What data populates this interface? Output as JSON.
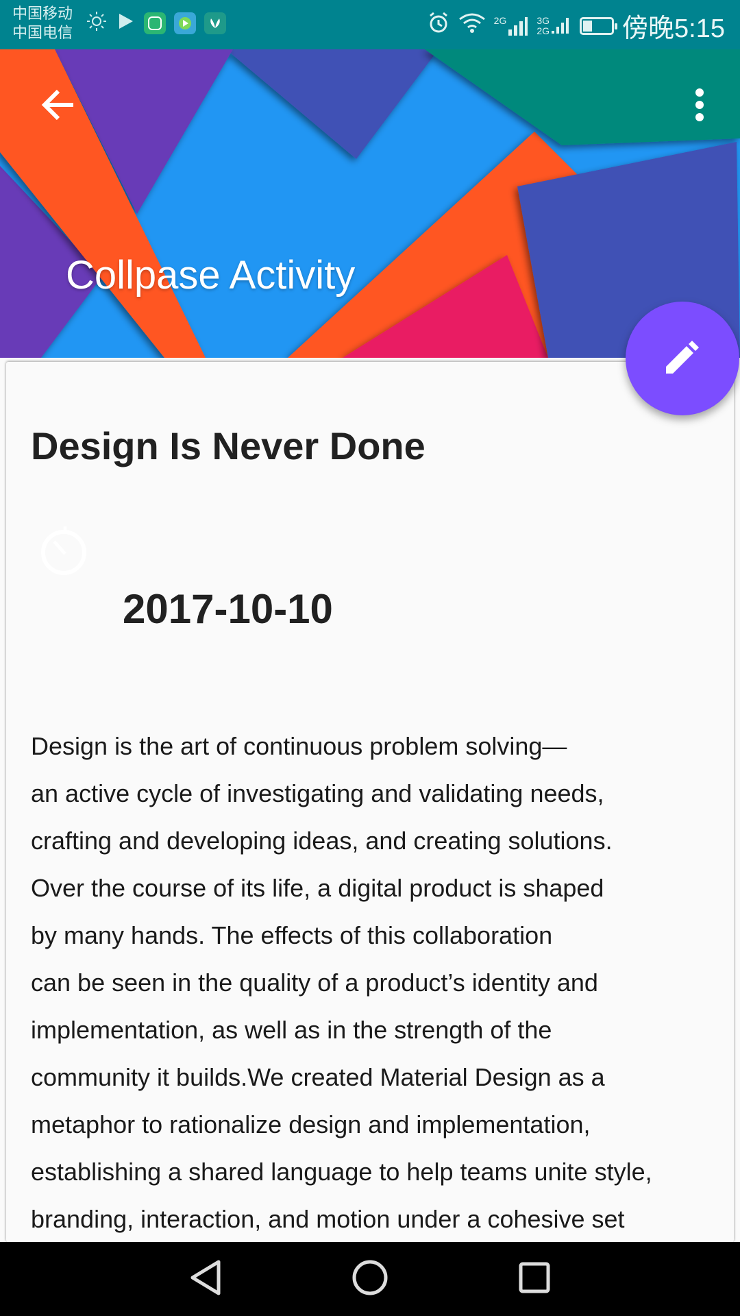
{
  "status_bar": {
    "carrier_1": "中国移动",
    "carrier_2": "中国电信",
    "app_icons": [
      "sun-icon",
      "play-store-icon",
      "meituan-icon",
      "video-icon",
      "huawei-icon"
    ],
    "net_top": "2G",
    "net_mid_1": "3G",
    "net_mid_2": "2G",
    "time": "傍晚5:15",
    "battery_level": 0.3
  },
  "toolbar": {
    "title": "Collpase Activity",
    "back_icon": "arrow-back-icon",
    "overflow_icon": "more-vert-icon"
  },
  "fab": {
    "icon": "edit-icon",
    "color": "#7c4dff"
  },
  "article": {
    "title": "Design Is Never Done",
    "date_icon": "clock-icon",
    "date": "2017-10-10",
    "body_lines": [
      "Design is the art of continuous problem solving—",
      "an active cycle of investigating and validating needs,",
      "crafting and developing ideas, and creating solutions.",
      "Over the course of its life, a digital product is shaped",
      "by many hands. The effects of this collaboration",
      "can be seen in the quality of a product’s identity and",
      "implementation, as well as in the strength of the",
      "community it builds.We created Material Design as a",
      "metaphor to rationalize design and implementation,",
      "establishing a shared language to help teams unite style,",
      "branding, interaction, and motion under a cohesive set"
    ]
  },
  "nav_bar": {
    "back": "nav-back-icon",
    "home": "nav-home-icon",
    "recents": "nav-recents-icon"
  },
  "colors": {
    "status_bar": "#00838f",
    "fab": "#7c4dff",
    "header_orange": "#ff5722",
    "header_purple": "#673ab7",
    "header_blue": "#2196f3",
    "header_indigo": "#3f51b5",
    "header_pink": "#e91e63",
    "header_teal": "#00897b"
  }
}
